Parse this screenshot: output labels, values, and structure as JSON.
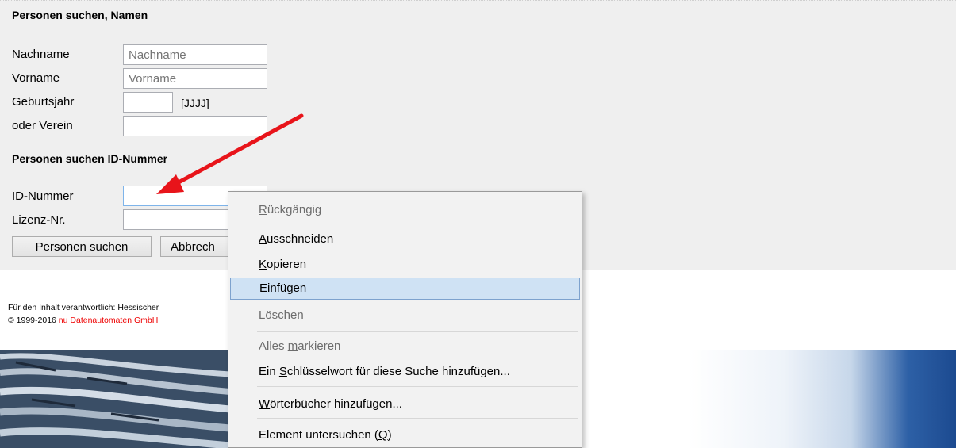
{
  "search": {
    "heading_name": "Personen suchen, Namen",
    "nachname_label": "Nachname",
    "nachname_placeholder": "Nachname",
    "vorname_label": "Vorname",
    "vorname_placeholder": "Vorname",
    "geburtsjahr_label": "Geburtsjahr",
    "geburtsjahr_format": "[JJJJ]",
    "verein_label": "oder Verein",
    "heading_id": "Personen suchen ID-Nummer",
    "id_label": "ID-Nummer",
    "lizenz_label": "Lizenz-Nr.",
    "search_button": "Personen suchen",
    "cancel_button": "Abbrech"
  },
  "footer": {
    "line1": "Für den Inhalt verantwortlich: Hessischer",
    "line2_prefix": "© 1999-2016 ",
    "line2_link": "nu Datenautomaten GmbH"
  },
  "context_menu": {
    "items": [
      {
        "pre": "",
        "key": "R",
        "post": "ückgängig",
        "disabled": true
      },
      {
        "pre": "",
        "key": "A",
        "post": "usschneiden",
        "disabled": false
      },
      {
        "pre": "",
        "key": "K",
        "post": "opieren",
        "disabled": false
      },
      {
        "pre": "",
        "key": "E",
        "post": "infügen",
        "disabled": false,
        "highlighted": true
      },
      {
        "pre": "",
        "key": "L",
        "post": "öschen",
        "disabled": true
      },
      {
        "pre": "Alles ",
        "key": "m",
        "post": "arkieren",
        "disabled": true
      },
      {
        "pre": "Ein ",
        "key": "S",
        "post": "chlüsselwort für diese Suche hinzufügen...",
        "disabled": false
      },
      {
        "pre": "",
        "key": "W",
        "post": "örterbücher hinzufügen...",
        "disabled": false
      },
      {
        "pre": "Element untersuchen (",
        "key": "Q",
        "post": ")",
        "disabled": false
      }
    ]
  },
  "colors": {
    "panel_bg": "#efefef",
    "menu_highlight": "#cfe2f4",
    "arrow": "#e8141a",
    "footer_link": "#ee0000"
  }
}
